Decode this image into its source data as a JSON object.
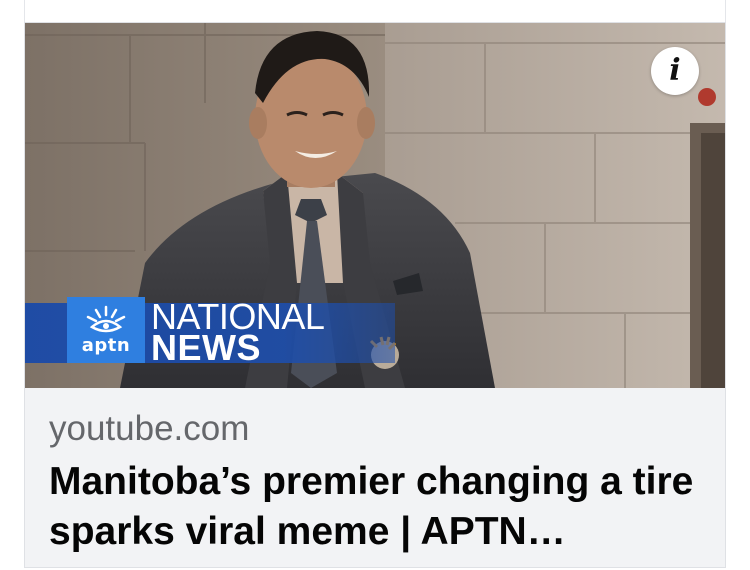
{
  "link_preview": {
    "domain": "youtube.com",
    "headline": "Manitoba’s premier changing a tire sparks viral meme | APTN…",
    "info_button_glyph": "i"
  },
  "thumbnail": {
    "overlay_brand": "aptn",
    "overlay_line1": "NATIONAL",
    "overlay_line2": "NEWS"
  },
  "colors": {
    "band_blue": "#1e4eaa",
    "logo_blue": "#2f7fe0",
    "domain_gray": "#65676b",
    "headline_black": "#050505",
    "card_bg": "#f2f3f5"
  },
  "icons": [
    "info-icon",
    "aptn-logo-icon"
  ]
}
